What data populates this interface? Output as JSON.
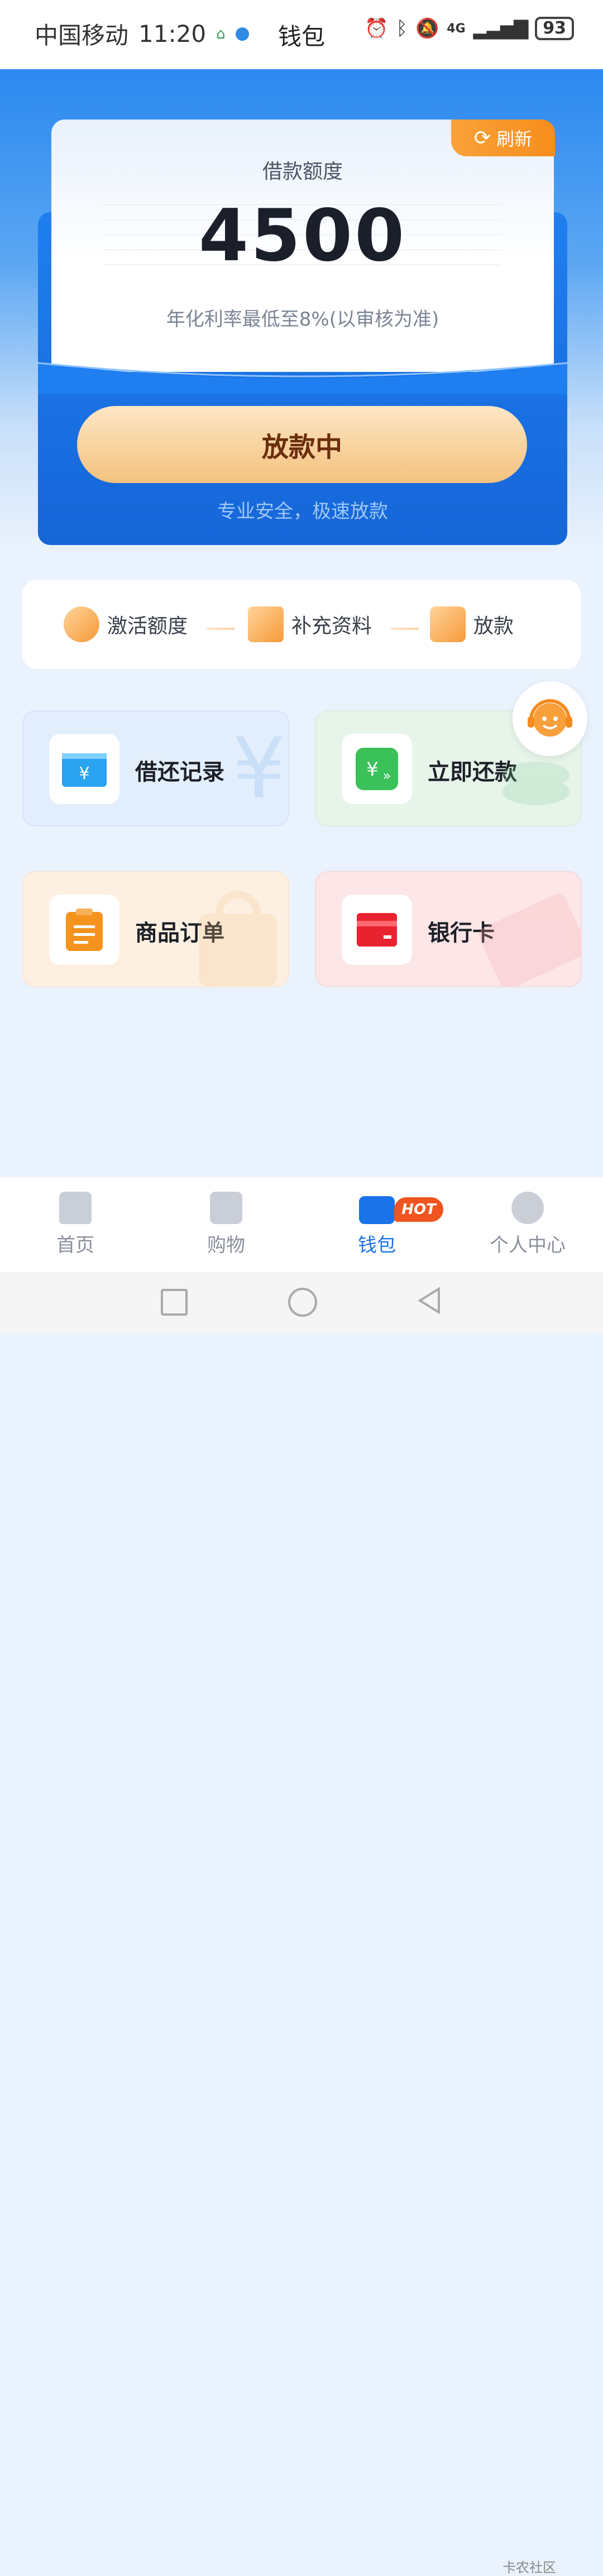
{
  "status_bar": {
    "carrier": "中国移动",
    "time": "11:20",
    "title": "钱包",
    "network": "4G",
    "battery": "93"
  },
  "credit_card": {
    "refresh_label": "刷新",
    "label": "借款额度",
    "amount": "4500",
    "rate_note": "年化利率最低至8%(以审核为准)",
    "button_label": "放款中",
    "button_subtitle": "专业安全，极速放款"
  },
  "steps": [
    {
      "label": "激活额度"
    },
    {
      "label": "补充资料"
    },
    {
      "label": "放款"
    }
  ],
  "tiles": [
    {
      "label": "借还记录",
      "icon": "yuan-card-icon",
      "color": "#e3eefc"
    },
    {
      "label": "立即还款",
      "icon": "repay-icon",
      "color": "#e6f4ea"
    },
    {
      "label": "商品订单",
      "icon": "clipboard-icon",
      "color": "#fdf0e2"
    },
    {
      "label": "银行卡",
      "icon": "bank-card-icon",
      "color": "#fde6e8"
    }
  ],
  "tabbar": {
    "items": [
      {
        "label": "首页",
        "icon": "home-icon"
      },
      {
        "label": "购物",
        "icon": "shopping-bag-icon"
      },
      {
        "label": "钱包",
        "icon": "wallet-icon"
      },
      {
        "label": "个人中心",
        "icon": "profile-icon"
      }
    ],
    "active_index": 2,
    "hot_badge": "HOT"
  },
  "watermark": "卡农社区"
}
